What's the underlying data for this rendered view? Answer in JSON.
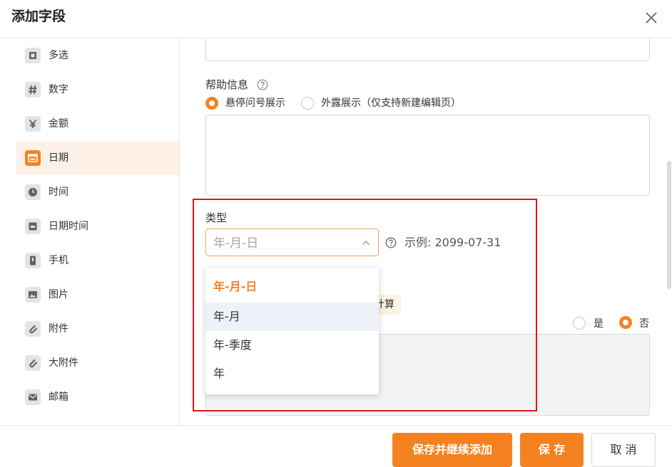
{
  "dialog": {
    "title": "添加字段"
  },
  "sidebar": {
    "items": [
      {
        "label": "多选",
        "icon": "multi-select-icon"
      },
      {
        "label": "数字",
        "icon": "hash-icon"
      },
      {
        "label": "金额",
        "icon": "yen-icon"
      },
      {
        "label": "日期",
        "icon": "calendar-icon",
        "active": true
      },
      {
        "label": "时间",
        "icon": "clock-icon"
      },
      {
        "label": "日期时间",
        "icon": "datetime-icon"
      },
      {
        "label": "手机",
        "icon": "phone-icon"
      },
      {
        "label": "图片",
        "icon": "image-icon"
      },
      {
        "label": "附件",
        "icon": "paperclip-icon"
      },
      {
        "label": "大附件",
        "icon": "large-attachment-icon"
      },
      {
        "label": "邮箱",
        "icon": "mail-icon"
      }
    ]
  },
  "form": {
    "help_info": {
      "label": "帮助信息",
      "options": [
        "悬停问号展示",
        "外露展示（仅支持新建编辑页）"
      ],
      "selected_index": 0
    },
    "type": {
      "label": "类型",
      "placeholder": "年-月-日",
      "example": "示例: 2099-07-31",
      "options": [
        "年-月-日",
        "年-月",
        "年-季度",
        "年"
      ],
      "selected_index": 0,
      "hover_index": 1
    },
    "badge": "计算",
    "yes_no": {
      "yes": "是",
      "no": "否",
      "selected": "no"
    }
  },
  "footer": {
    "save_continue": "保存并继续添加",
    "save": "保 存",
    "cancel": "取 消"
  },
  "colors": {
    "accent": "#f58220",
    "highlight": "#e0141e"
  }
}
